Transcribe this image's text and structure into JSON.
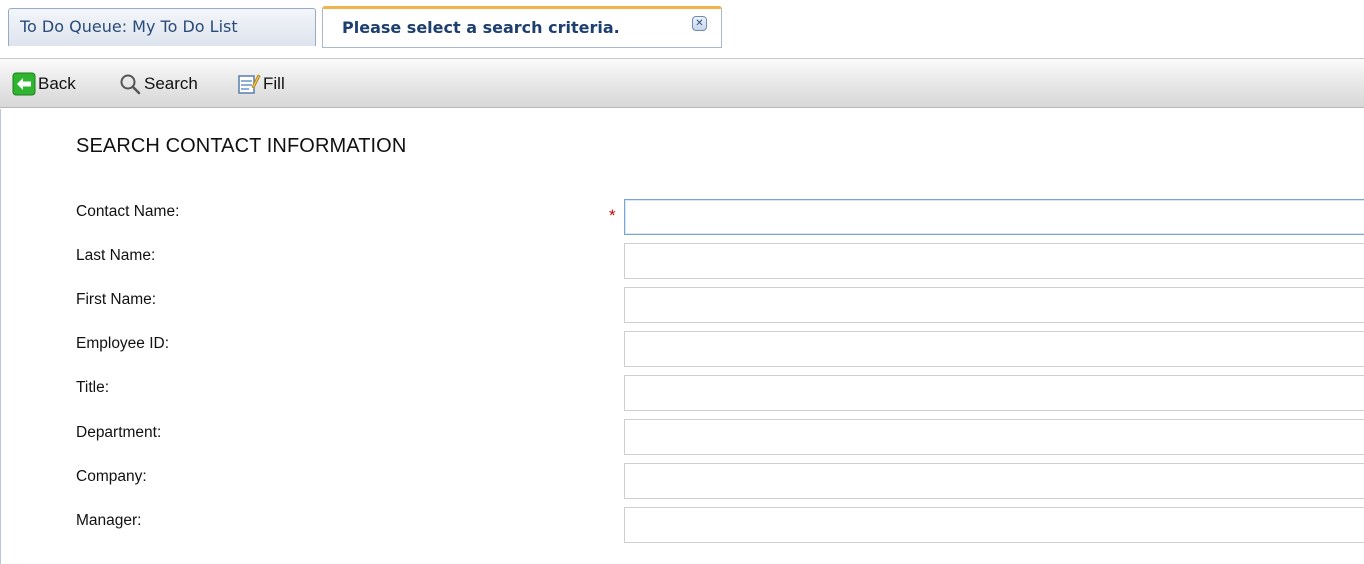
{
  "tabs": [
    {
      "label": "To Do Queue: My To Do List",
      "active": false
    },
    {
      "label": "Please select a search criteria.",
      "active": true
    }
  ],
  "toolbar": {
    "back_label": "Back",
    "search_label": "Search",
    "fill_label": "Fill"
  },
  "form": {
    "title": "SEARCH CONTACT INFORMATION",
    "required_marker": "*",
    "fields": [
      {
        "label": "Contact Name:",
        "value": "",
        "required": true
      },
      {
        "label": "Last Name:",
        "value": ""
      },
      {
        "label": "First Name:",
        "value": ""
      },
      {
        "label": "Employee ID:",
        "value": ""
      },
      {
        "label": "Title:",
        "value": ""
      },
      {
        "label": "Department:",
        "value": ""
      },
      {
        "label": "Company:",
        "value": ""
      },
      {
        "label": "Manager:",
        "value": ""
      }
    ]
  },
  "icons": {
    "tab_close": "close-icon",
    "back": "back-arrow-icon",
    "search": "magnifier-icon",
    "fill": "form-fill-icon"
  },
  "colors": {
    "accent": "#f3b24a",
    "tab_text": "#1d3f6e",
    "required": "#cc0000"
  }
}
